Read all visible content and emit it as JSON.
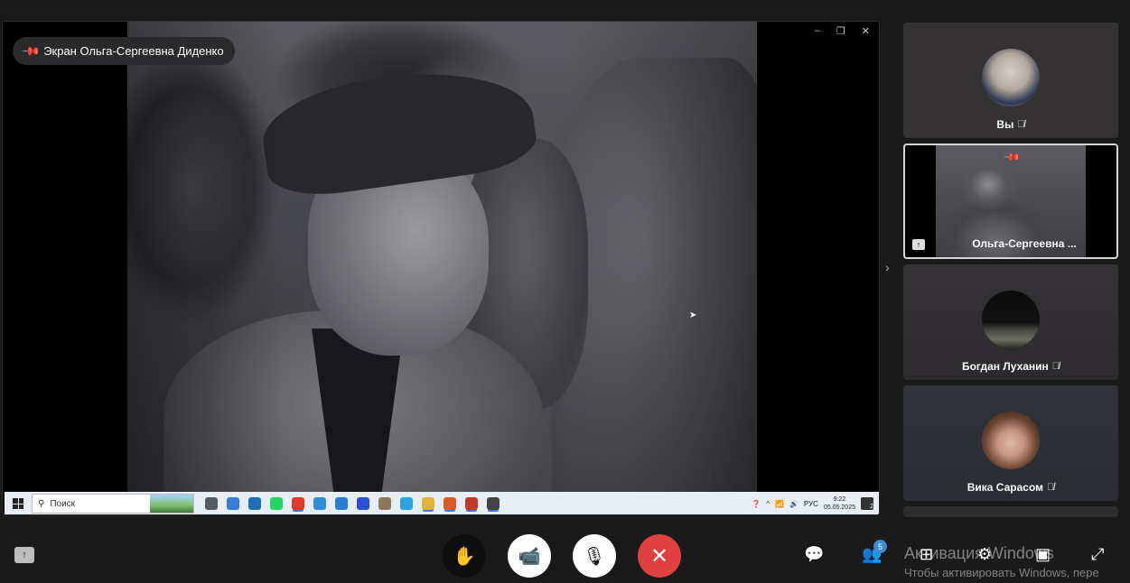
{
  "main": {
    "pinned_label": "Экран Ольга-Сергеевна Диденко",
    "window_controls": [
      "–",
      "❐",
      "✕"
    ]
  },
  "taskbar": {
    "search_placeholder": "Поиск",
    "language": "РУС",
    "time": "9:22",
    "date": "05.05.2025",
    "notification_count": "2",
    "icon_colors": [
      "#555a66",
      "#3a7bd5",
      "#1e6fb8",
      "#25d366",
      "#e03a2f",
      "#2f8fd8",
      "#2b7cd3",
      "#2b4fd8",
      "#8a7a5a",
      "#2aa3e0",
      "#e0b23a",
      "#e05a2a",
      "#c0392b",
      "#444"
    ]
  },
  "participants": [
    {
      "name": "Вы",
      "muted": true
    },
    {
      "name": "Ольга-Сергеевна ...",
      "muted": false,
      "pinned": true,
      "sharing": true
    },
    {
      "name": "Богдан Луханин",
      "muted": true
    },
    {
      "name": "Вика Сарасом",
      "muted": true
    }
  ],
  "controls": {
    "people_count": "5"
  },
  "watermark": {
    "line1": "Активация Windows",
    "line2": "Чтобы активировать Windows, пере"
  }
}
